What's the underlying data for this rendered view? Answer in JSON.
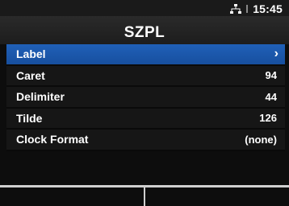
{
  "status": {
    "time": "15:45",
    "network_icon": "network-icon",
    "signal_icon": "signal-icon"
  },
  "header": {
    "title": "SZPL"
  },
  "menu": {
    "items": [
      {
        "label": "Label",
        "value": "",
        "chevron": "›",
        "selected": true
      },
      {
        "label": "Caret",
        "value": "94"
      },
      {
        "label": "Delimiter",
        "value": "44"
      },
      {
        "label": "Tilde",
        "value": "126"
      },
      {
        "label": "Clock Format",
        "value": "(none)"
      }
    ]
  },
  "colors": {
    "selected": "#1f5fb4",
    "background": "#0d0d0d"
  }
}
